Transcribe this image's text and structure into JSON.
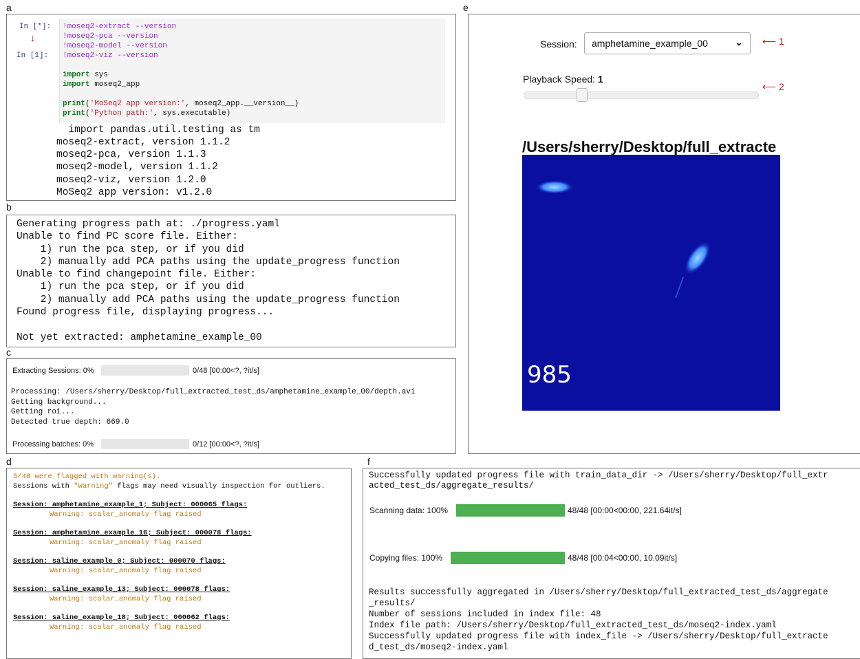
{
  "panel_labels": {
    "a": "a",
    "b": "b",
    "c": "c",
    "d": "d",
    "e": "e",
    "f": "f"
  },
  "panel_a": {
    "prompt_running": "In [*]:",
    "prompt_done": "In [1]:",
    "code": {
      "l1_cmd": "!moseq2-extract",
      "l1_flag": "--version",
      "l2_cmd": "!moseq2-pca",
      "l2_flag": "--version",
      "l3_cmd": "!moseq2-model",
      "l3_flag": "--version",
      "l4_cmd": "!moseq2-viz",
      "l4_flag": "--version",
      "l5_kw": "import",
      "l5_rest": " sys",
      "l6_kw": "import",
      "l6_rest": " moseq2_app",
      "l7_kw": "print",
      "l7_open": "(",
      "l7_str": "'MoSeq2 app version:'",
      "l7_rest": ", moseq2_app.__version__)",
      "l8_kw": "print",
      "l8_open": "(",
      "l8_str": "'Python path:'",
      "l8_rest": ", sys.executable)"
    },
    "output": [
      "  import pandas.util.testing as tm",
      "moseq2-extract, version 1.1.2",
      "moseq2-pca, version 1.1.3",
      "moseq2-model, version 1.1.2",
      "moseq2-viz, version 1.2.0",
      "MoSeq2 app version: v1.2.0"
    ]
  },
  "panel_b": {
    "lines": [
      "Generating progress path at: ./progress.yaml",
      "Unable to find PC score file. Either:",
      "    1) run the pca step, or if you did",
      "    2) manually add PCA paths using the update_progress function",
      "Unable to find changepoint file. Either:",
      "    1) run the pca step, or if you did",
      "    2) manually add PCA paths using the update_progress function",
      "Found progress file, displaying progress...",
      "",
      "Not yet extracted: amphetamine_example_00"
    ]
  },
  "panel_c": {
    "extract_label": "Extracting Sessions: 0%",
    "extract_stats": "0/48 [00:00<?, ?it/s]",
    "extract_progress": 0,
    "log": [
      "Processing: /Users/sherry/Desktop/full_extracted_test_ds/amphetamine_example_00/depth.avi",
      "Getting background...",
      "Getting roi...",
      "Detected true depth: 669.0"
    ],
    "batch_label": "Processing batches: 0%",
    "batch_stats": "0/12 [00:00<?, ?it/s]",
    "batch_progress": 0
  },
  "panel_d": {
    "header": "5/48 were flagged with warning(s).",
    "note_pre": "Sessions with ",
    "note_quote": "\"Warning\"",
    "note_post": " flags may need visually inspection for outliers.",
    "entries": [
      {
        "session": "Session: amphetamine_example_1; Subject: 000065 flags:",
        "warning": "Warning: scalar_anomaly flag raised"
      },
      {
        "session": "Session: amphetamine_example_16; Subject: 000078 flags:",
        "warning": "Warning: scalar_anomaly flag raised"
      },
      {
        "session": "Session: saline_example_0; Subject: 000070 flags:",
        "warning": "Warning: scalar_anomaly flag raised"
      },
      {
        "session": "Session: saline_example_13; Subject: 000078 flags:",
        "warning": "Warning: scalar_anomaly flag raised"
      },
      {
        "session": "Session: saline_example_18; Subject: 000062 flags:",
        "warning": "Warning: scalar_anomaly flag raised"
      }
    ]
  },
  "panel_e": {
    "session_label": "Session:",
    "session_value": "amphetamine_example_00",
    "playback_label": "Playback Speed:",
    "playback_value": "1",
    "annotation_1": "1",
    "annotation_2": "2",
    "video_title": "/Users/sherry/Desktop/full_extracte",
    "frame_number": "985",
    "video_bg": "#0a0fa0"
  },
  "panel_f": {
    "line1": "Successfully updated progress file with train_data_dir -> /Users/sherry/Desktop/full_extr",
    "line2": "acted_test_ds/aggregate_results/",
    "scan_label": "Scanning data: 100%",
    "scan_stats": "48/48 [00:00<00:00, 221.64it/s]",
    "scan_progress": 1.0,
    "copy_label": "Copying files: 100%",
    "copy_stats": "48/48 [00:04<00:00, 10.09it/s]",
    "copy_progress": 1.0,
    "result_lines": [
      "Results successfully aggregated in /Users/sherry/Desktop/full_extracted_test_ds/aggregate",
      "_results/",
      "Number of sessions included in index file: 48",
      "Index file path: /Users/sherry/Desktop/full_extracted_test_ds/moseq2-index.yaml",
      "Successfully updated progress file with index_file -> /Users/sherry/Desktop/full_extracte",
      "d_test_ds/moseq2-index.yaml"
    ],
    "bar_color": "#4caf50"
  }
}
